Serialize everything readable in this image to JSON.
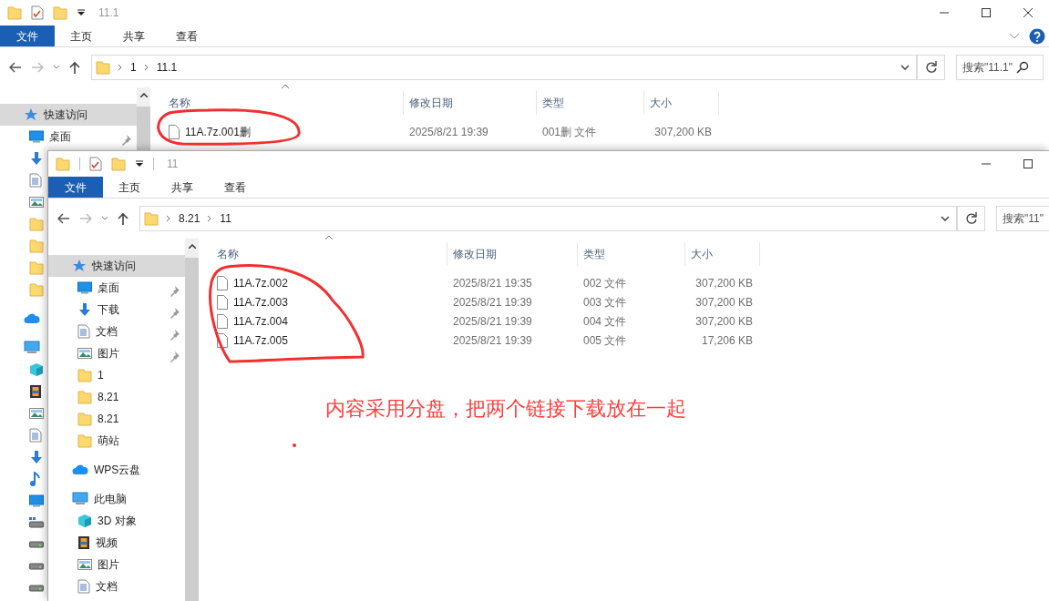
{
  "back_window": {
    "title": "11.1",
    "ribbon_tabs": [
      {
        "label": "文件",
        "selected": true
      },
      {
        "label": "主页",
        "selected": false
      },
      {
        "label": "共享",
        "selected": false
      },
      {
        "label": "查看",
        "selected": false
      }
    ],
    "breadcrumb": [
      "1",
      "11.1"
    ],
    "search": {
      "placeholder": "搜索\"11.1\""
    },
    "sidebar": [
      {
        "kind": "star",
        "label": "快速访问",
        "selected": true,
        "pinned": false
      },
      {
        "kind": "desktop",
        "label": "桌面",
        "selected": false,
        "pinned": true
      },
      {
        "kind": "download",
        "selected": false
      },
      {
        "kind": "document",
        "selected": false
      },
      {
        "kind": "picture",
        "selected": false
      },
      {
        "kind": "folder",
        "selected": false
      },
      {
        "kind": "folder",
        "selected": false
      },
      {
        "kind": "folder",
        "selected": false
      },
      {
        "kind": "folder",
        "selected": false
      },
      {
        "kind": "cloud",
        "selected": false
      },
      {
        "kind": "pc",
        "selected": false
      },
      {
        "kind": "cube",
        "selected": false
      },
      {
        "kind": "video",
        "selected": false
      },
      {
        "kind": "picture",
        "selected": false
      },
      {
        "kind": "document",
        "selected": false
      },
      {
        "kind": "download",
        "selected": false
      },
      {
        "kind": "music",
        "selected": false
      },
      {
        "kind": "desktop",
        "selected": false
      },
      {
        "kind": "netdrive",
        "selected": false
      },
      {
        "kind": "drive",
        "selected": false
      },
      {
        "kind": "drive",
        "selected": false
      },
      {
        "kind": "drive",
        "selected": false
      }
    ],
    "columns": [
      "名称",
      "修改日期",
      "类型",
      "大小"
    ],
    "files": [
      {
        "name": "11A.7z.001删",
        "modified": "2025/8/21 19:39",
        "type": "001删 文件",
        "size": "307,200 KB"
      }
    ]
  },
  "front_window": {
    "title": "11",
    "ribbon_tabs": [
      {
        "label": "文件",
        "selected": true
      },
      {
        "label": "主页",
        "selected": false
      },
      {
        "label": "共享",
        "selected": false
      },
      {
        "label": "查看",
        "selected": false
      }
    ],
    "breadcrumb": [
      "8.21",
      "11"
    ],
    "search": {
      "placeholder": "搜索\"11\""
    },
    "sidebar": [
      {
        "kind": "star",
        "label": "快速访问",
        "selected": true,
        "pinned": false
      },
      {
        "kind": "desktop",
        "label": "桌面",
        "selected": false,
        "pinned": true
      },
      {
        "kind": "download",
        "label": "下载",
        "selected": false,
        "pinned": true
      },
      {
        "kind": "document",
        "label": "文档",
        "selected": false,
        "pinned": true
      },
      {
        "kind": "picture",
        "label": "图片",
        "selected": false,
        "pinned": true
      },
      {
        "kind": "folder",
        "label": "1",
        "selected": false,
        "pinned": false
      },
      {
        "kind": "folder",
        "label": "8.21",
        "selected": false,
        "pinned": false
      },
      {
        "kind": "folder",
        "label": "8.21",
        "selected": false,
        "pinned": false
      },
      {
        "kind": "folder",
        "label": "萌站",
        "selected": false,
        "pinned": false
      },
      {
        "kind": "cloud",
        "label": "WPS云盘",
        "selected": false,
        "pinned": false
      },
      {
        "kind": "pc",
        "label": "此电脑",
        "selected": false,
        "pinned": false
      },
      {
        "kind": "cube",
        "label": "3D 对象",
        "selected": false,
        "pinned": false
      },
      {
        "kind": "video",
        "label": "视频",
        "selected": false,
        "pinned": false
      },
      {
        "kind": "picture",
        "label": "图片",
        "selected": false,
        "pinned": false
      },
      {
        "kind": "document",
        "label": "文档",
        "selected": false,
        "pinned": false
      }
    ],
    "columns": [
      "名称",
      "修改日期",
      "类型",
      "大小"
    ],
    "files": [
      {
        "name": "11A.7z.002",
        "modified": "2025/8/21 19:35",
        "type": "002 文件",
        "size": "307,200 KB"
      },
      {
        "name": "11A.7z.003",
        "modified": "2025/8/21 19:39",
        "type": "003 文件",
        "size": "307,200 KB"
      },
      {
        "name": "11A.7z.004",
        "modified": "2025/8/21 19:39",
        "type": "004 文件",
        "size": "307,200 KB"
      },
      {
        "name": "11A.7z.005",
        "modified": "2025/8/21 19:39",
        "type": "005 文件",
        "size": "17,206 KB"
      }
    ]
  },
  "annotation": {
    "text": "内容采用分盘，把两个链接下载放在一起"
  }
}
